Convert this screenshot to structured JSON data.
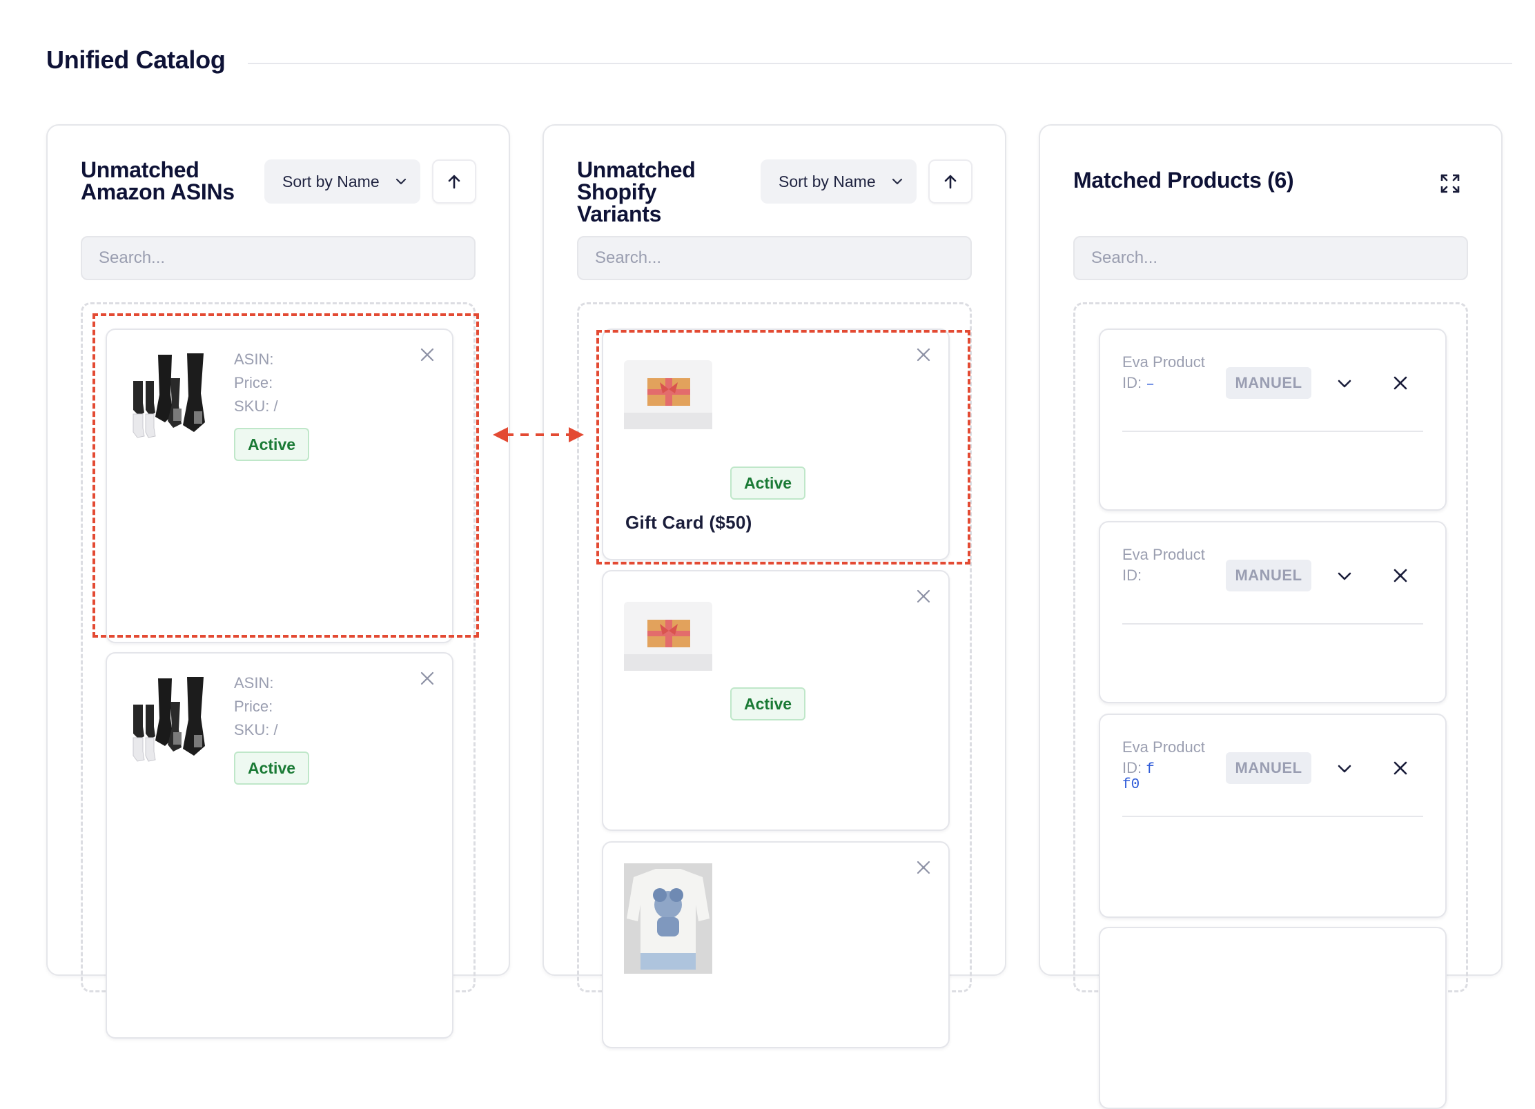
{
  "page": {
    "title": "Unified Catalog"
  },
  "amazon": {
    "title": "Unmatched Amazon ASINs",
    "sort": {
      "selected": "Sort by Name"
    },
    "search": {
      "placeholder": "Search..."
    },
    "items": [
      {
        "asin_label": "ASIN:",
        "price_label": "Price:",
        "sku_label": "SKU:",
        "sku_value": "/",
        "status": "Active"
      },
      {
        "asin_label": "ASIN:",
        "price_label": "Price:",
        "sku_label": "SKU:",
        "sku_value": "/",
        "status": "Active"
      }
    ]
  },
  "shopify": {
    "title": "Unmatched Shopify Variants",
    "sort": {
      "selected": "Sort by Name"
    },
    "search": {
      "placeholder": "Search..."
    },
    "items": [
      {
        "status": "Active",
        "name": "Gift Card ($50)"
      },
      {
        "status": "Active",
        "name": ""
      },
      {
        "status": "",
        "name": ""
      }
    ]
  },
  "matched": {
    "title": "Matched Products (6)",
    "search": {
      "placeholder": "Search..."
    },
    "items": [
      {
        "label": "Eva Product",
        "id_label": "ID:",
        "id_value": "–",
        "id_value2": "",
        "source": "MANUEL"
      },
      {
        "label": "Eva Product",
        "id_label": "ID:",
        "id_value": "",
        "id_value2": "",
        "source": "MANUEL"
      },
      {
        "label": "Eva Product",
        "id_label": "ID:",
        "id_value": "f",
        "id_value2": "f0",
        "source": "MANUEL"
      }
    ]
  },
  "colors": {
    "accent_highlight": "#e34a33",
    "active_green": "#1a7a35",
    "title_navy": "#0e1236"
  },
  "icons": [
    "chevron-down-icon",
    "arrow-up-icon",
    "close-icon",
    "expand-icon",
    "double-arrow-icon"
  ]
}
